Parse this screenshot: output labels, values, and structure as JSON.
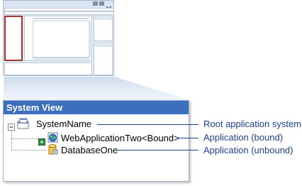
{
  "panel": {
    "title": "System View"
  },
  "tree": {
    "root_label": "SystemName",
    "child1_label": "WebApplicationTwo<Bound>",
    "child2_label": "DatabaseOne"
  },
  "callouts": {
    "root": "Root application system",
    "bound": "Application (bound)",
    "unbound": "Application (unbound)"
  },
  "colors": {
    "header": "#3d6fbf",
    "highlight": "#a0322a",
    "callout": "#1f3f8f"
  },
  "icons": [
    "minimize-icon",
    "maximize-icon",
    "close-icon",
    "collapse-icon",
    "expand-icon",
    "system-icon",
    "web-application-icon",
    "database-icon"
  ]
}
